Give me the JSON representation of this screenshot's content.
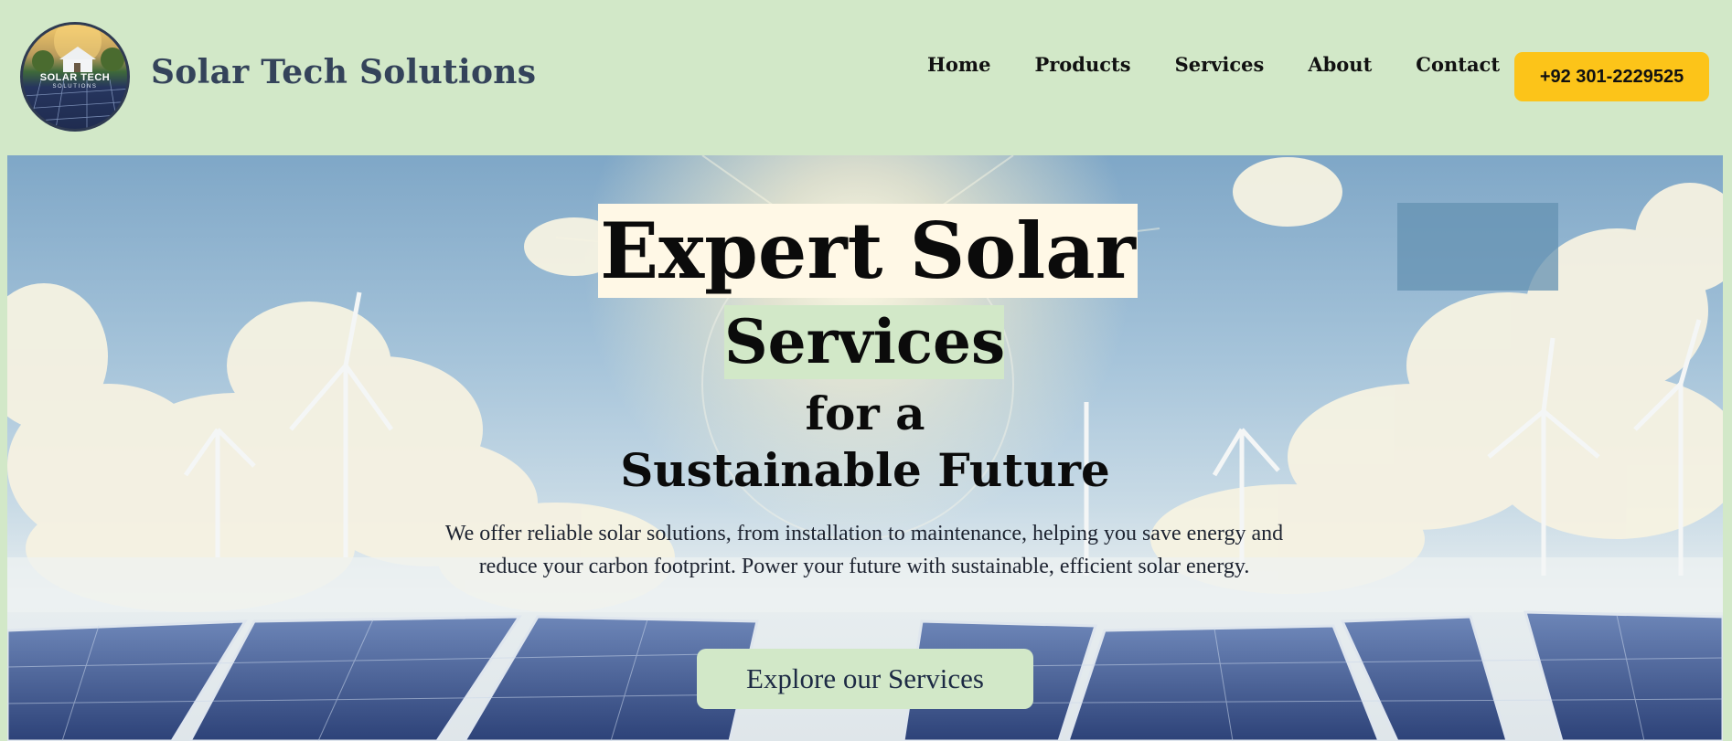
{
  "header": {
    "logo": {
      "text": "SOLAR TECH",
      "subtext": "SOLUTIONS"
    },
    "brand": "Solar Tech Solutions",
    "nav": [
      {
        "label": "Home"
      },
      {
        "label": "Products"
      },
      {
        "label": "Services"
      },
      {
        "label": "About"
      },
      {
        "label": "Contact"
      }
    ],
    "phone": "+92 301-2229525"
  },
  "hero": {
    "title_line1": "Expert Solar",
    "title_line2": "Services",
    "title_line3": "for a",
    "title_line4": "Sustainable Future",
    "description": "We offer reliable solar solutions, from installation to maintenance, helping you save energy and reduce your carbon footprint. Power your future with sustainable, efficient solar energy.",
    "cta_label": "Explore our Services"
  },
  "colors": {
    "header_bg": "#d2e8c8",
    "accent_button": "#fcc419",
    "brand_text": "#34435a",
    "title_highlight_1": "#fff8e6",
    "title_highlight_2": "#d2e8c8"
  }
}
